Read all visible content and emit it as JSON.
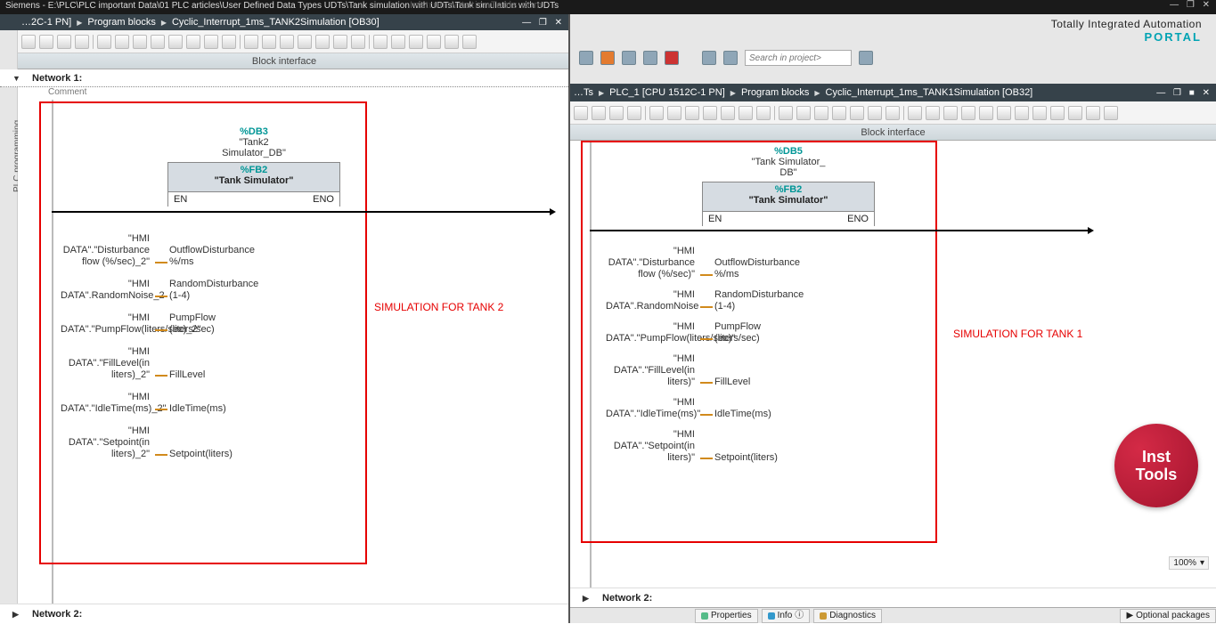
{
  "titleBar": {
    "text": "Siemens  - E:\\PLC\\PLC important Data\\01 PLC articles\\User Defined Data Types UDTs\\Tank simulation with UDTs\\Tank simulation with UDTs",
    "watermark": "InstrumentationTools.com"
  },
  "global": {
    "searchPlaceholder": "Search in project>",
    "brandLine1": "Totally Integrated Automation",
    "brandLine2": "PORTAL"
  },
  "leftPane": {
    "gutterLabel": "PLC programming",
    "crumb": {
      "p1": "…2C-1 PN]",
      "p2": "Program blocks",
      "p3": "Cyclic_Interrupt_1ms_TANK2Simulation [OB30]"
    },
    "blockInterface": "Block interface",
    "networkHead": "Network 1:",
    "comment": "Comment",
    "net2": "Network 2:",
    "redLabel": "SIMULATION FOR TANK 2",
    "call": {
      "dbTag": "%DB3",
      "dbName1": "\"Tank2",
      "dbName2": "Simulator_DB\"",
      "fbTag": "%FB2",
      "fbName": "\"Tank Simulator\"",
      "en": "EN",
      "eno": "ENO"
    },
    "params": [
      {
        "tag": "\"HMI DATA\".\"Disturbance flow (%/sec)_2\"",
        "name": "OutflowDisturbance %/ms"
      },
      {
        "tag": "\"HMI DATA\".RandomNoise_2",
        "name": "RandomDisturbance (1-4)"
      },
      {
        "tag": "\"HMI DATA\".\"PumpFlow(liters/sec)_2\"",
        "name": "PumpFlow (liters/sec)"
      },
      {
        "tag": "\"HMI DATA\".\"FillLevel(in liters)_2\"",
        "name": "FillLevel"
      },
      {
        "tag": "\"HMI DATA\".\"IdleTime(ms)_2\"",
        "name": "IdleTime(ms)"
      },
      {
        "tag": "\"HMI DATA\".\"Setpoint(in liters)_2\"",
        "name": "Setpoint(liters)"
      }
    ]
  },
  "rightPane": {
    "crumb": {
      "p0": "…Ts",
      "p1": "PLC_1 [CPU 1512C-1 PN]",
      "p2": "Program blocks",
      "p3": "Cyclic_Interrupt_1ms_TANK1Simulation [OB32]"
    },
    "blockInterface": "Block interface",
    "net2": "Network 2:",
    "redLabel": "SIMULATION FOR TANK 1",
    "zoom": "100%",
    "call": {
      "dbTag": "%DB5",
      "dbName1": "\"Tank Simulator_",
      "dbName2": "DB\"",
      "fbTag": "%FB2",
      "fbName": "\"Tank Simulator\"",
      "en": "EN",
      "eno": "ENO"
    },
    "params": [
      {
        "tag": "\"HMI DATA\".\"Disturbance flow (%/sec)\"",
        "name": "OutflowDisturbance %/ms"
      },
      {
        "tag": "\"HMI DATA\".RandomNoise",
        "name": "RandomDisturbance (1-4)"
      },
      {
        "tag": "\"HMI DATA\".\"PumpFlow(liters/sec)\"",
        "name": "PumpFlow (liters/sec)"
      },
      {
        "tag": "\"HMI DATA\".\"FillLevel(in liters)\"",
        "name": "FillLevel"
      },
      {
        "tag": "\"HMI DATA\".\"IdleTime(ms)\"",
        "name": "IdleTime(ms)"
      },
      {
        "tag": "\"HMI DATA\".\"Setpoint(in liters)\"",
        "name": "Setpoint(liters)"
      }
    ],
    "bottomTabs": {
      "properties": "Properties",
      "info": "Info",
      "diagnostics": "Diagnostics",
      "optional": "Optional packages"
    }
  },
  "stamp": {
    "l1": "Inst",
    "l2": "Tools"
  }
}
